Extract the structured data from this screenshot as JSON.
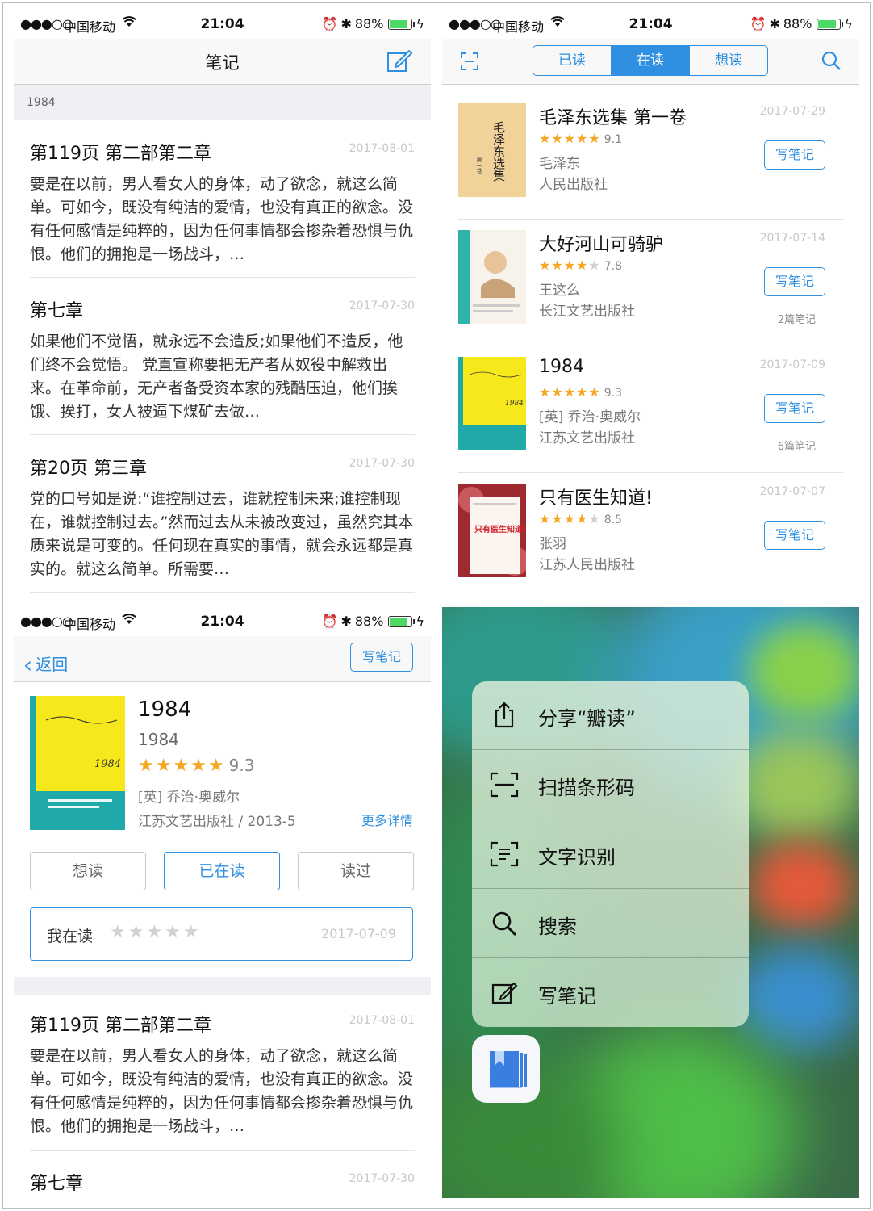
{
  "status": {
    "signal": "●●●○○",
    "carrier": "中国移动",
    "time": "21:04",
    "battery": "88%"
  },
  "notes_screen": {
    "title": "笔记",
    "section": "1984",
    "notes": [
      {
        "title": "第119页  第二部第二章",
        "date": "2017-08-01",
        "body": "要是在以前，男人看女人的身体，动了欲念，就这么简单。可如今，既没有纯洁的爱情，也没有真正的欲念。没有任何感情是纯粹的，因为任何事情都会掺杂着恐惧与仇恨。他们的拥抱是一场战斗，…"
      },
      {
        "title": "第七章",
        "date": "2017-07-30",
        "body": "如果他们不觉悟，就永远不会造反;如果他们不造反，他们终不会觉悟。  党直宣称要把无产者从奴役中解救出来。在革命前，无产者备受资本家的残酷压迫，他们挨饿、挨打，女人被逼下煤矿去做…"
      },
      {
        "title": "第20页  第三章",
        "date": "2017-07-30",
        "body": "党的口号如是说:“谁控制过去，谁就控制未来;谁控制现在，谁就控制过去。”然而过去从未被改变过，虽然究其本质来说是可变的。任何现在真实的事情，就会永远都是真实的。就这么简单。所需要…"
      }
    ]
  },
  "books_screen": {
    "tabs": [
      "已读",
      "在读",
      "想读"
    ],
    "active_tab": "在读",
    "write_label": "写笔记",
    "books": [
      {
        "title": "毛泽东选集 第一卷",
        "stars_full": "★★★★",
        "stars_half": "★",
        "stars_empty": "",
        "score": "9.1",
        "author": "毛泽东",
        "publisher": "人民出版社",
        "date": "2017-07-29",
        "notes": ""
      },
      {
        "title": "大好河山可骑驴",
        "stars_full": "★★★★",
        "stars_half": "",
        "stars_empty": "★",
        "score": "7.8",
        "author": "王这么",
        "publisher": "长江文艺出版社",
        "date": "2017-07-14",
        "notes": "2篇笔记"
      },
      {
        "title": "1984",
        "stars_full": "★★★★",
        "stars_half": "★",
        "stars_empty": "",
        "score": "9.3",
        "author": "[英] 乔治·奥威尔",
        "publisher": "江苏文艺出版社",
        "date": "2017-07-09",
        "notes": "6篇笔记"
      },
      {
        "title": "只有医生知道!",
        "stars_full": "★★★★",
        "stars_half": "",
        "stars_empty": "★",
        "score": "8.5",
        "author": "张羽",
        "publisher": "江苏人民出版社",
        "date": "2017-07-07",
        "notes": ""
      }
    ],
    "cover_texts": {
      "mao": "毛泽东选集",
      "mao_sub": "第一卷",
      "doctor": "只有医生知道!"
    }
  },
  "detail_screen": {
    "back": "返回",
    "write": "写笔记",
    "title": "1984",
    "subtitle": "1984",
    "stars": "★★★★★",
    "score": "9.3",
    "author": "[英] 乔治·奥威尔",
    "publisher": "江苏文艺出版社 / 2013-5",
    "more": "更多详情",
    "status_buttons": [
      "想读",
      "已在读",
      "读过"
    ],
    "reading_label": "我在读",
    "reading_stars": "★★★★★",
    "reading_date": "2017-07-09",
    "notes": [
      {
        "title": "第119页  第二部第二章",
        "date": "2017-08-01",
        "body": "要是在以前，男人看女人的身体，动了欲念，就这么简单。可如今，既没有纯洁的爱情，也没有真正的欲念。没有任何感情是纯粹的，因为任何事情都会掺杂着恐惧与仇恨。他们的拥抱是一场战斗，…"
      },
      {
        "title": "第七章",
        "date": "2017-07-30",
        "body": ""
      }
    ]
  },
  "quick_actions": {
    "items": [
      {
        "label": "分享“瓣读”",
        "icon": "share-icon"
      },
      {
        "label": "扫描条形码",
        "icon": "barcode-scan-icon"
      },
      {
        "label": "文字识别",
        "icon": "text-recognition-icon"
      },
      {
        "label": "搜索",
        "icon": "search-icon"
      },
      {
        "label": "写笔记",
        "icon": "compose-icon"
      }
    ]
  },
  "colors": {
    "accent": "#2f8fe0",
    "star": "#f5a623",
    "battery": "#4cd964"
  }
}
